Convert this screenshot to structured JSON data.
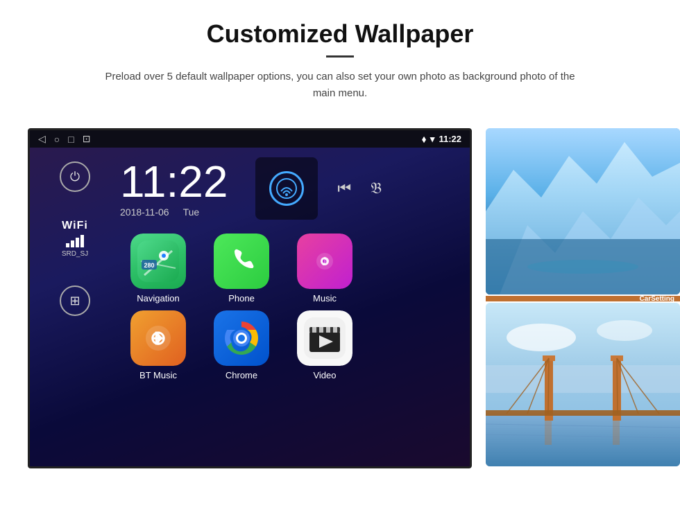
{
  "header": {
    "title": "Customized Wallpaper",
    "subtitle": "Preload over 5 default wallpaper options, you can also set your own photo as background photo of the main menu."
  },
  "statusBar": {
    "time": "11:22",
    "navIcons": [
      "◁",
      "○",
      "□",
      "⊡"
    ],
    "rightIcons": [
      "location",
      "wifi",
      "signal"
    ],
    "wifiLabel": "WiFi",
    "wifiSSID": "SRD_SJ"
  },
  "clockWidget": {
    "time": "11:22",
    "date": "2018-11-06",
    "day": "Tue"
  },
  "apps": [
    {
      "label": "Navigation",
      "icon": "nav",
      "color1": "#4dd98a",
      "color2": "#1aaa50"
    },
    {
      "label": "Phone",
      "icon": "phone",
      "color1": "#4de85a",
      "color2": "#2ccc40"
    },
    {
      "label": "Music",
      "icon": "music",
      "color1": "#e840a0",
      "color2": "#c020d0"
    },
    {
      "label": "BT Music",
      "icon": "bluetooth",
      "color1": "#f0a030",
      "color2": "#e06020"
    },
    {
      "label": "Chrome",
      "icon": "chrome",
      "color1": "#1a73e8",
      "color2": "#0052cc"
    },
    {
      "label": "Video",
      "icon": "video",
      "color1": "#f8f8f8",
      "color2": "#e0e0e0"
    }
  ],
  "sidebar": {
    "wifiText": "WiFi",
    "ssid": "SRD_SJ"
  }
}
